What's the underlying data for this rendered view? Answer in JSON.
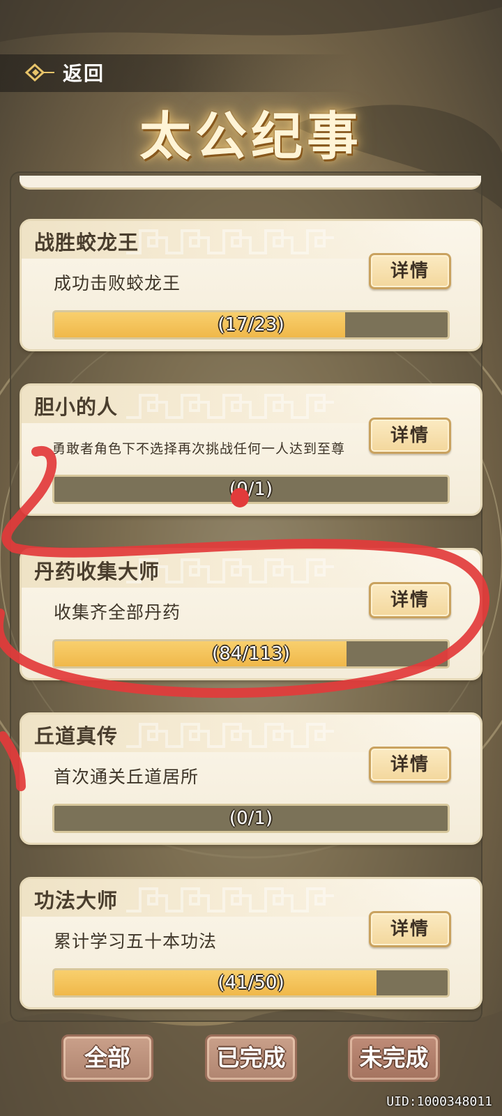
{
  "header": {
    "back_label": "返回",
    "title": "太公纪事"
  },
  "details_label": "详情",
  "achievements": [
    {
      "title": "战胜蛟龙王",
      "description": "成功击败蛟龙王",
      "current": 17,
      "total": 23,
      "progress_text": "(17/23)"
    },
    {
      "title": "胆小的人",
      "description": "勇敢者角色下不选择再次挑战任何一人达到至尊",
      "current": 0,
      "total": 1,
      "progress_text": "(0/1)"
    },
    {
      "title": "丹药收集大师",
      "description": "收集齐全部丹药",
      "current": 84,
      "total": 113,
      "progress_text": "(84/113)"
    },
    {
      "title": "丘道真传",
      "description": "首次通关丘道居所",
      "current": 0,
      "total": 1,
      "progress_text": "(0/1)"
    },
    {
      "title": "功法大师",
      "description": "累计学习五十本功法",
      "current": 41,
      "total": 50,
      "progress_text": "(41/50)"
    }
  ],
  "tabs": [
    {
      "label": "全部"
    },
    {
      "label": "已完成"
    },
    {
      "label": "未完成",
      "selected": true
    }
  ],
  "footer": {
    "uid": "UID:1000348011"
  },
  "colors": {
    "progress_fill": "#f0b84a",
    "progress_track": "#7b7258",
    "card_bg": "#fbf6ea",
    "tab_bg": "#b08570",
    "annotation_red": "#e23b3b"
  }
}
